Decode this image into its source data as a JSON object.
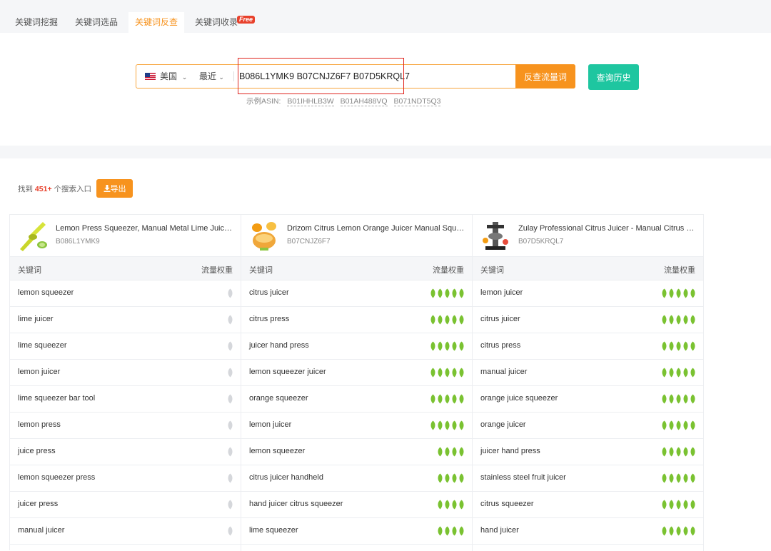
{
  "tabs": [
    {
      "label": "关键词挖掘",
      "active": false
    },
    {
      "label": "关键词选品",
      "active": false
    },
    {
      "label": "关键词反查",
      "active": true
    },
    {
      "label": "关键词收录",
      "active": false,
      "badge": "Free"
    }
  ],
  "search": {
    "country": "美国",
    "period": "最近",
    "asin_value": "B086L1YMK9 B07CNJZ6F7 B07D5KRQL7",
    "submit_label": "反查流量词",
    "history_label": "查询历史",
    "examples_label": "示例ASIN:",
    "examples": [
      "B01IHHLB3W",
      "B01AH488VQ",
      "B071NDT5Q3"
    ]
  },
  "results": {
    "prefix": "找到",
    "count": "451+",
    "suffix": "个搜索入口",
    "export_label": "导出"
  },
  "colors": {
    "accent": "#f7931e",
    "teal": "#1ec6a0",
    "leaf_active": "#7ac231",
    "leaf_inactive": "#d5d7db",
    "highlight": "#e0261f"
  },
  "columns_header": {
    "keyword": "关键词",
    "weight": "流量权重"
  },
  "products": [
    {
      "title": "Lemon Press Squeezer, Manual Metal Lime Juicer with Handle",
      "asin": "B086L1YMK9",
      "thumb": "lemon-squeezer-image",
      "keywords": [
        {
          "kw": "lemon squeezer",
          "weight": 0,
          "leaves": 1
        },
        {
          "kw": "lime juicer",
          "weight": 0,
          "leaves": 1
        },
        {
          "kw": "lime squeezer",
          "weight": 0,
          "leaves": 1
        },
        {
          "kw": "lemon juicer",
          "weight": 0,
          "leaves": 1
        },
        {
          "kw": "lime squeezer bar tool",
          "weight": 0,
          "leaves": 1
        },
        {
          "kw": "lemon press",
          "weight": 0,
          "leaves": 1
        },
        {
          "kw": "juice press",
          "weight": 0,
          "leaves": 1
        },
        {
          "kw": "lemon squeezer press",
          "weight": 0,
          "leaves": 1
        },
        {
          "kw": "juicer press",
          "weight": 0,
          "leaves": 1
        },
        {
          "kw": "manual juicer",
          "weight": 0,
          "leaves": 1
        }
      ]
    },
    {
      "title": "Drizom Citrus Lemon Orange Juicer Manual Squeezer",
      "asin": "B07CNJZ6F7",
      "thumb": "orange-juicer-image",
      "keywords": [
        {
          "kw": "citrus juicer",
          "weight": 5,
          "leaves": 5
        },
        {
          "kw": "citrus press",
          "weight": 5,
          "leaves": 5
        },
        {
          "kw": "juicer hand press",
          "weight": 5,
          "leaves": 5
        },
        {
          "kw": "lemon squeezer juicer",
          "weight": 5,
          "leaves": 5
        },
        {
          "kw": "orange squeezer",
          "weight": 5,
          "leaves": 5
        },
        {
          "kw": "lemon juicer",
          "weight": 5,
          "leaves": 5
        },
        {
          "kw": "lemon squeezer",
          "weight": 4,
          "leaves": 4
        },
        {
          "kw": "citrus juicer handheld",
          "weight": 4,
          "leaves": 4
        },
        {
          "kw": "hand juicer citrus squeezer",
          "weight": 4,
          "leaves": 4
        },
        {
          "kw": "lime squeezer",
          "weight": 4,
          "leaves": 4
        }
      ]
    },
    {
      "title": "Zulay Professional Citrus Juicer - Manual Citrus Press",
      "asin": "B07D5KRQL7",
      "thumb": "citrus-press-image",
      "keywords": [
        {
          "kw": "lemon juicer",
          "weight": 5,
          "leaves": 5
        },
        {
          "kw": "citrus juicer",
          "weight": 5,
          "leaves": 5
        },
        {
          "kw": "citrus press",
          "weight": 5,
          "leaves": 5
        },
        {
          "kw": "manual juicer",
          "weight": 5,
          "leaves": 5
        },
        {
          "kw": "orange juice squeezer",
          "weight": 5,
          "leaves": 5
        },
        {
          "kw": "orange juicer",
          "weight": 5,
          "leaves": 5
        },
        {
          "kw": "juicer hand press",
          "weight": 5,
          "leaves": 5
        },
        {
          "kw": "stainless steel fruit juicer",
          "weight": 5,
          "leaves": 5
        },
        {
          "kw": "citrus squeezer",
          "weight": 5,
          "leaves": 5
        },
        {
          "kw": "hand juicer",
          "weight": 5,
          "leaves": 5
        }
      ]
    }
  ]
}
